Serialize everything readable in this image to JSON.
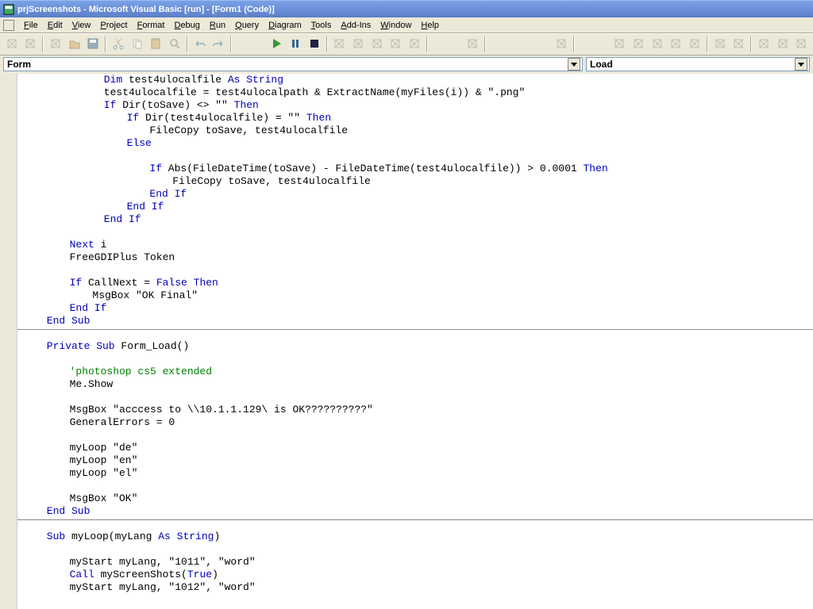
{
  "title": "prjScreenshots - Microsoft Visual Basic [run] - [Form1 (Code)]",
  "menu": [
    "File",
    "Edit",
    "View",
    "Project",
    "Format",
    "Debug",
    "Run",
    "Query",
    "Diagram",
    "Tools",
    "Add-Ins",
    "Window",
    "Help"
  ],
  "combos": {
    "left": "Form",
    "right": "Load"
  },
  "code": [
    {
      "i": 14,
      "t": "Dim test4ulocalfile As String",
      "k": [
        "Dim",
        "As String"
      ]
    },
    {
      "i": 14,
      "t": "test4ulocalfile = test4ulocalpath & ExtractName(myFiles(i)) & \".png\""
    },
    {
      "i": 14,
      "t": "If Dir(toSave) <> \"\" Then",
      "k": [
        "If",
        "Then"
      ]
    },
    {
      "i": 18,
      "t": "If Dir(test4ulocalfile) = \"\" Then",
      "k": [
        "If",
        "Then"
      ]
    },
    {
      "i": 22,
      "t": "FileCopy toSave, test4ulocalfile"
    },
    {
      "i": 18,
      "t": "Else",
      "k": [
        "Else"
      ]
    },
    {
      "i": 0,
      "t": ""
    },
    {
      "i": 22,
      "t": "If Abs(FileDateTime(toSave) - FileDateTime(test4ulocalfile)) > 0.0001 Then",
      "k": [
        "If",
        "Then"
      ]
    },
    {
      "i": 26,
      "t": "FileCopy toSave, test4ulocalfile"
    },
    {
      "i": 22,
      "t": "End If",
      "k": [
        "End If"
      ]
    },
    {
      "i": 18,
      "t": "End If",
      "k": [
        "End If"
      ]
    },
    {
      "i": 14,
      "t": "End If",
      "k": [
        "End If"
      ]
    },
    {
      "i": 0,
      "t": ""
    },
    {
      "i": 8,
      "t": "Next i",
      "k": [
        "Next"
      ]
    },
    {
      "i": 8,
      "t": "FreeGDIPlus Token"
    },
    {
      "i": 0,
      "t": ""
    },
    {
      "i": 8,
      "t": "If CallNext = False Then",
      "k": [
        "If",
        "False",
        "Then"
      ]
    },
    {
      "i": 12,
      "t": "MsgBox \"OK Final\""
    },
    {
      "i": 8,
      "t": "End If",
      "k": [
        "End If"
      ]
    },
    {
      "i": 4,
      "t": "End Sub",
      "k": [
        "End Sub"
      ],
      "hr_after": true
    },
    {
      "i": 0,
      "t": ""
    },
    {
      "i": 4,
      "t": "Private Sub Form_Load()",
      "k": [
        "Private Sub"
      ]
    },
    {
      "i": 0,
      "t": ""
    },
    {
      "i": 8,
      "t": "'photoshop cs5 extended",
      "c": true
    },
    {
      "i": 8,
      "t": "Me.Show"
    },
    {
      "i": 0,
      "t": ""
    },
    {
      "i": 8,
      "t": "MsgBox \"acccess to \\\\10.1.1.129\\ is OK??????????\""
    },
    {
      "i": 8,
      "t": "GeneralErrors = 0"
    },
    {
      "i": 0,
      "t": ""
    },
    {
      "i": 8,
      "t": "myLoop \"de\""
    },
    {
      "i": 8,
      "t": "myLoop \"en\""
    },
    {
      "i": 8,
      "t": "myLoop \"el\""
    },
    {
      "i": 0,
      "t": ""
    },
    {
      "i": 8,
      "t": "MsgBox \"OK\""
    },
    {
      "i": 4,
      "t": "End Sub",
      "k": [
        "End Sub"
      ],
      "hr_after": true
    },
    {
      "i": 0,
      "t": ""
    },
    {
      "i": 4,
      "t": "Sub myLoop(myLang As String)",
      "k": [
        "Sub",
        "As String"
      ]
    },
    {
      "i": 0,
      "t": ""
    },
    {
      "i": 8,
      "t": "myStart myLang, \"1011\", \"word\""
    },
    {
      "i": 8,
      "t": "Call myScreenShots(True)",
      "k": [
        "Call",
        "True"
      ]
    },
    {
      "i": 8,
      "t": "myStart myLang, \"1012\", \"word\""
    }
  ],
  "toolbar_icons": [
    "add-module-dropdown",
    "add-form-dropdown",
    "sep",
    "menu-editor",
    "open",
    "save",
    "sep",
    "cut",
    "copy",
    "paste",
    "find",
    "sep",
    "undo",
    "redo",
    "sep",
    "gap",
    "run",
    "pause",
    "stop",
    "sep",
    "project-explorer",
    "properties",
    "form-layout",
    "object-browser",
    "toolbox",
    "sep",
    "gap",
    "data-view",
    "sep",
    "gap-lg",
    "show-grid",
    "sep",
    "gap",
    "toggle-breakpoint",
    "comment",
    "step-into",
    "step-over",
    "step-out",
    "sep",
    "indent",
    "outdent",
    "sep",
    "hand",
    "bookmark",
    "next-bookmark"
  ]
}
